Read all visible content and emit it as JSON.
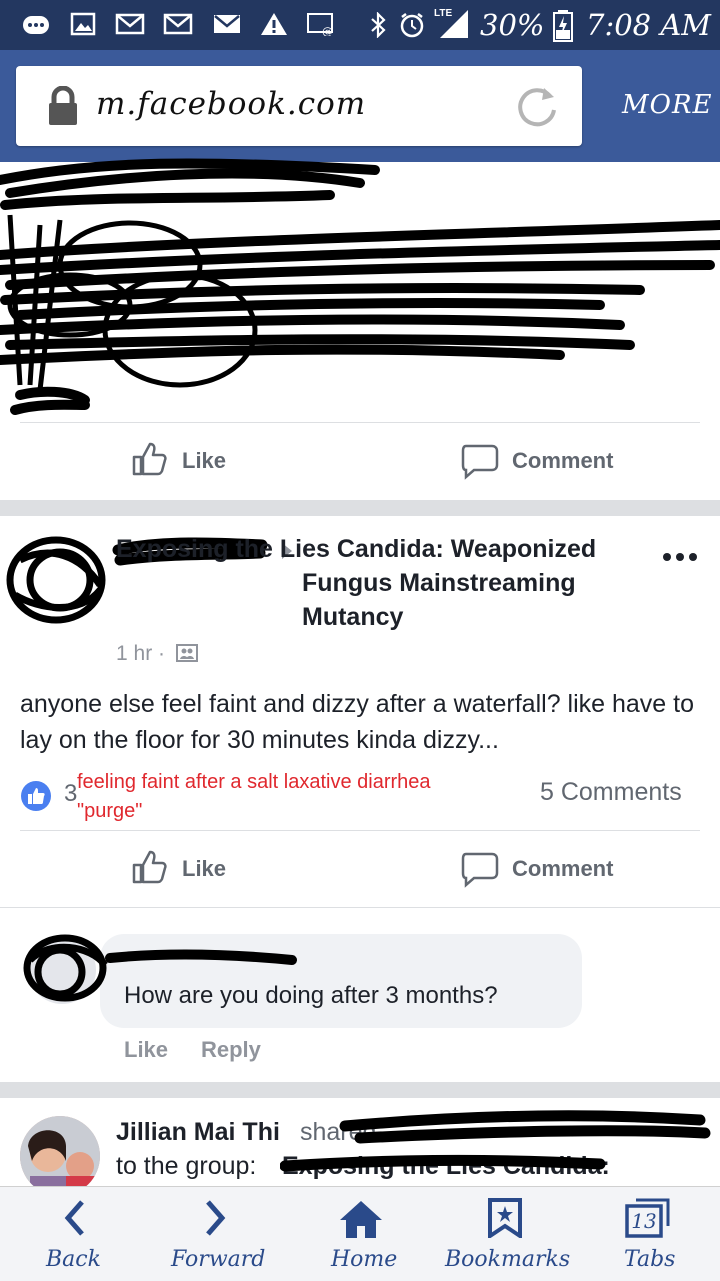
{
  "status_bar": {
    "battery": "30%",
    "time": "7:08 AM",
    "network": "LTE",
    "icons": [
      "chat-icon",
      "image-icon",
      "mail-icon",
      "mail-icon",
      "mail-icon",
      "warning-icon",
      "wifi-call-icon",
      "bluetooth-icon",
      "alarm-icon",
      "signal-icon",
      "battery-icon"
    ]
  },
  "browser": {
    "url": "m.facebook.com",
    "more_label": "MORE"
  },
  "post1": {
    "like_label": "Like",
    "comment_label": "Comment"
  },
  "post2": {
    "group_name": "Exposing the Lies Candida: Weaponized Fungus Mainstreaming Mutancy",
    "time": "1 hr ·",
    "text": "anyone else feel faint and dizzy after a waterfall? like have to lay on the floor for 30 minutes kinda dizzy...",
    "reactions_count": "3",
    "annotation": "feeling faint after a salt laxative diarrhea \"purge\"",
    "comments_count": "5 Comments",
    "like_label": "Like",
    "comment_label": "Comment"
  },
  "comment": {
    "text": "How are you doing after 3 months?",
    "like_label": "Like",
    "reply_label": "Reply"
  },
  "post3": {
    "author": "Jillian Mai Thi",
    "shared_label": "shared",
    "group_line": "to the group:",
    "group_partial": "Exposing the Lies Candida:"
  },
  "bottom_nav": {
    "back": "Back",
    "forward": "Forward",
    "home": "Home",
    "bookmarks": "Bookmarks",
    "tabs": "Tabs",
    "tabs_count": "13"
  },
  "colors": {
    "status_bar": "#233760",
    "app_bar": "#3b5a9a",
    "like_blue": "#4a7ff0",
    "annotation_red": "#e0282e"
  }
}
